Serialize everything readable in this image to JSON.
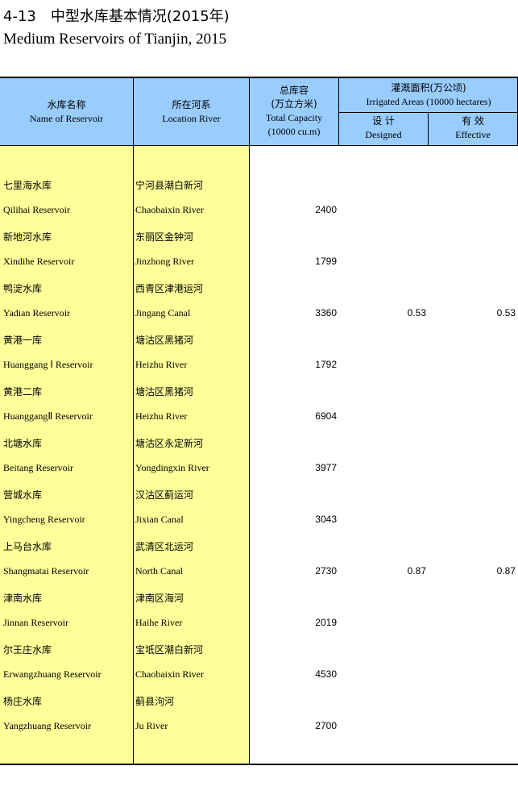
{
  "title_zh": "4-13　中型水库基本情况(2015年)",
  "title_en": "Medium Reservoirs of Tianjin, 2015",
  "columns": {
    "name": {
      "zh": "水库名称",
      "en": "Name of Reservoir"
    },
    "river": {
      "zh": "所在河系",
      "en": "Location River"
    },
    "capacity": {
      "zh1": "总库容",
      "zh2": "(万立方米)",
      "en1": "Total Capacity",
      "en2": "(10000 cu.m)"
    },
    "irrigated": {
      "zh": "灌溉面积(万公顷)",
      "en": "Irrigated Areas (10000 hectares)"
    },
    "designed": {
      "zh": "设 计",
      "en": "Designed"
    },
    "effective": {
      "zh": "有 效",
      "en": "Effective"
    }
  },
  "rows": [
    {
      "name_zh": "七里海水库",
      "river_zh": "宁河县潮白新河",
      "name_en": "Qilihai Reservoir",
      "river_en": "Chaobaixin River",
      "capacity": "2400",
      "designed": "",
      "effective": ""
    },
    {
      "name_zh": "新地河水库",
      "river_zh": "东丽区金钟河",
      "name_en": "Xindihe Reservoir",
      "river_en": "Jinzhong River",
      "capacity": "1799",
      "designed": "",
      "effective": ""
    },
    {
      "name_zh": "鸭淀水库",
      "river_zh": "西青区津港运河",
      "name_en": "Yadian Reservoir",
      "river_en": "Jingang Canal",
      "capacity": "3360",
      "designed": "0.53",
      "effective": "0.53"
    },
    {
      "name_zh": "黄港一库",
      "river_zh": "塘沽区黑猪河",
      "name_en": "Huanggang Ⅰ Reservoir",
      "river_en": "Heizhu River",
      "capacity": "1792",
      "designed": "",
      "effective": ""
    },
    {
      "name_zh": "黄港二库",
      "river_zh": "塘沽区黑猪河",
      "name_en": "HuanggangⅡ Reservoir",
      "river_en": "Heizhu River",
      "capacity": "6904",
      "designed": "",
      "effective": ""
    },
    {
      "name_zh": "北塘水库",
      "river_zh": "塘沽区永定新河",
      "name_en": "Beitang Reservoir",
      "river_en": "Yongdingxin River",
      "capacity": "3977",
      "designed": "",
      "effective": ""
    },
    {
      "name_zh": "营城水库",
      "river_zh": "汉沽区蓟运河",
      "name_en": "Yingcheng Reservoir",
      "river_en": "Jixian Canal",
      "capacity": "3043",
      "designed": "",
      "effective": ""
    },
    {
      "name_zh": "上马台水库",
      "river_zh": "武清区北运河",
      "name_en": "Shangmatai Reservoir",
      "river_en": "North Canal",
      "capacity": "2730",
      "designed": "0.87",
      "effective": "0.87"
    },
    {
      "name_zh": "津南水库",
      "river_zh": "津南区海河",
      "name_en": "Jinnan Reservoir",
      "river_en": "Haihe River",
      "capacity": "2019",
      "designed": "",
      "effective": ""
    },
    {
      "name_zh": "尔王庄水库",
      "river_zh": "宝坻区潮白新河",
      "name_en": "Erwangzhuang Reservoir",
      "river_en": "Chaobaixin River",
      "capacity": "4530",
      "designed": "",
      "effective": ""
    },
    {
      "name_zh": "杨庄水库",
      "river_zh": "蓟县泃河",
      "name_en": "Yangzhuang Reservoir",
      "river_en": "Ju River",
      "capacity": "2700",
      "designed": "",
      "effective": ""
    }
  ]
}
